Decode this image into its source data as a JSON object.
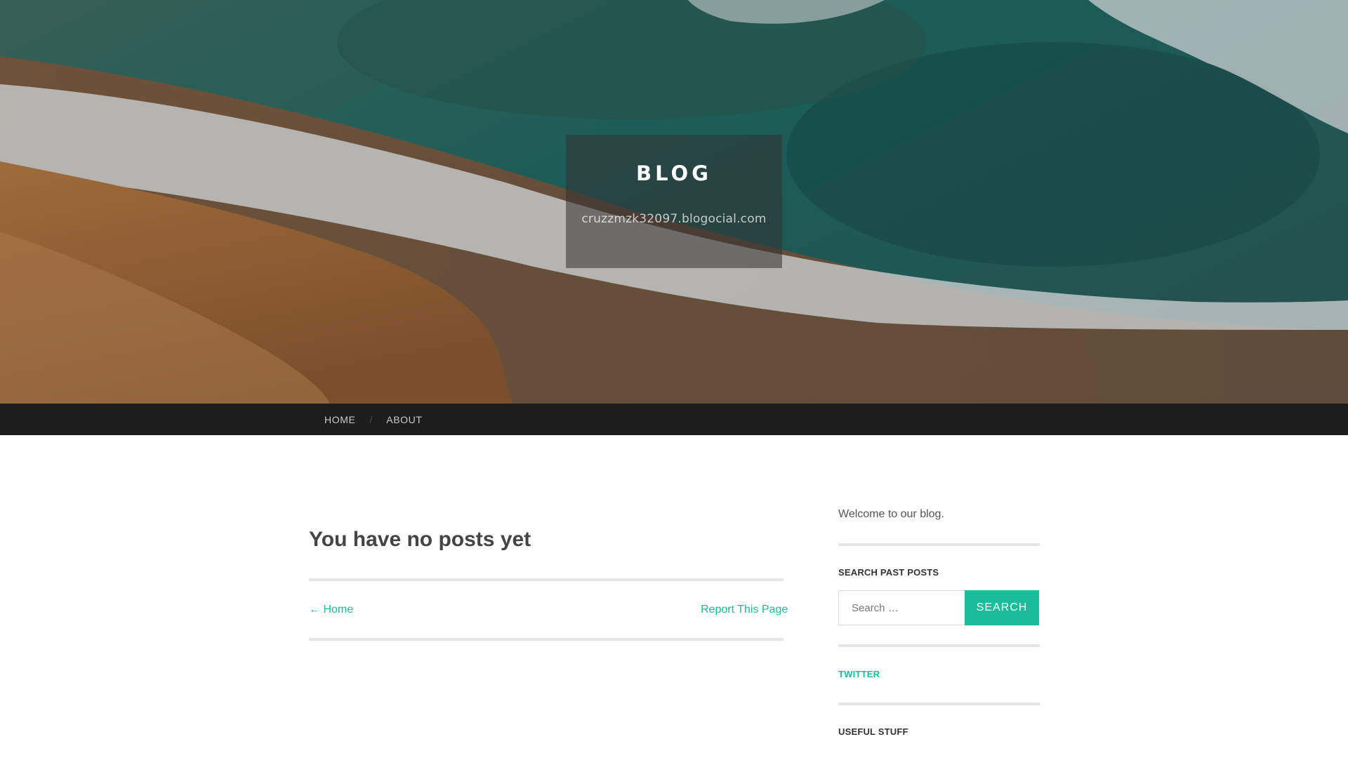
{
  "header": {
    "site_title": "BLOG",
    "site_description": "cruzzmzk32097.blogocial.com"
  },
  "nav": {
    "items": [
      {
        "label": "HOME"
      },
      {
        "label": "ABOUT"
      }
    ],
    "separator": "/"
  },
  "main": {
    "post_title": "You have no posts yet",
    "prev_link": "← Home",
    "report_link": "Report This Page"
  },
  "sidebar": {
    "welcome_text": "Welcome to our blog.",
    "search_widget_title": "SEARCH PAST POSTS",
    "search_placeholder": "Search …",
    "search_button_label": "SEARCH",
    "twitter_link": "TWITTER",
    "useful_stuff_title": "USEFUL STUFF"
  },
  "colors": {
    "accent": "#1abc9c",
    "nav_background": "#1d1d1d",
    "title_text": "#444444"
  }
}
